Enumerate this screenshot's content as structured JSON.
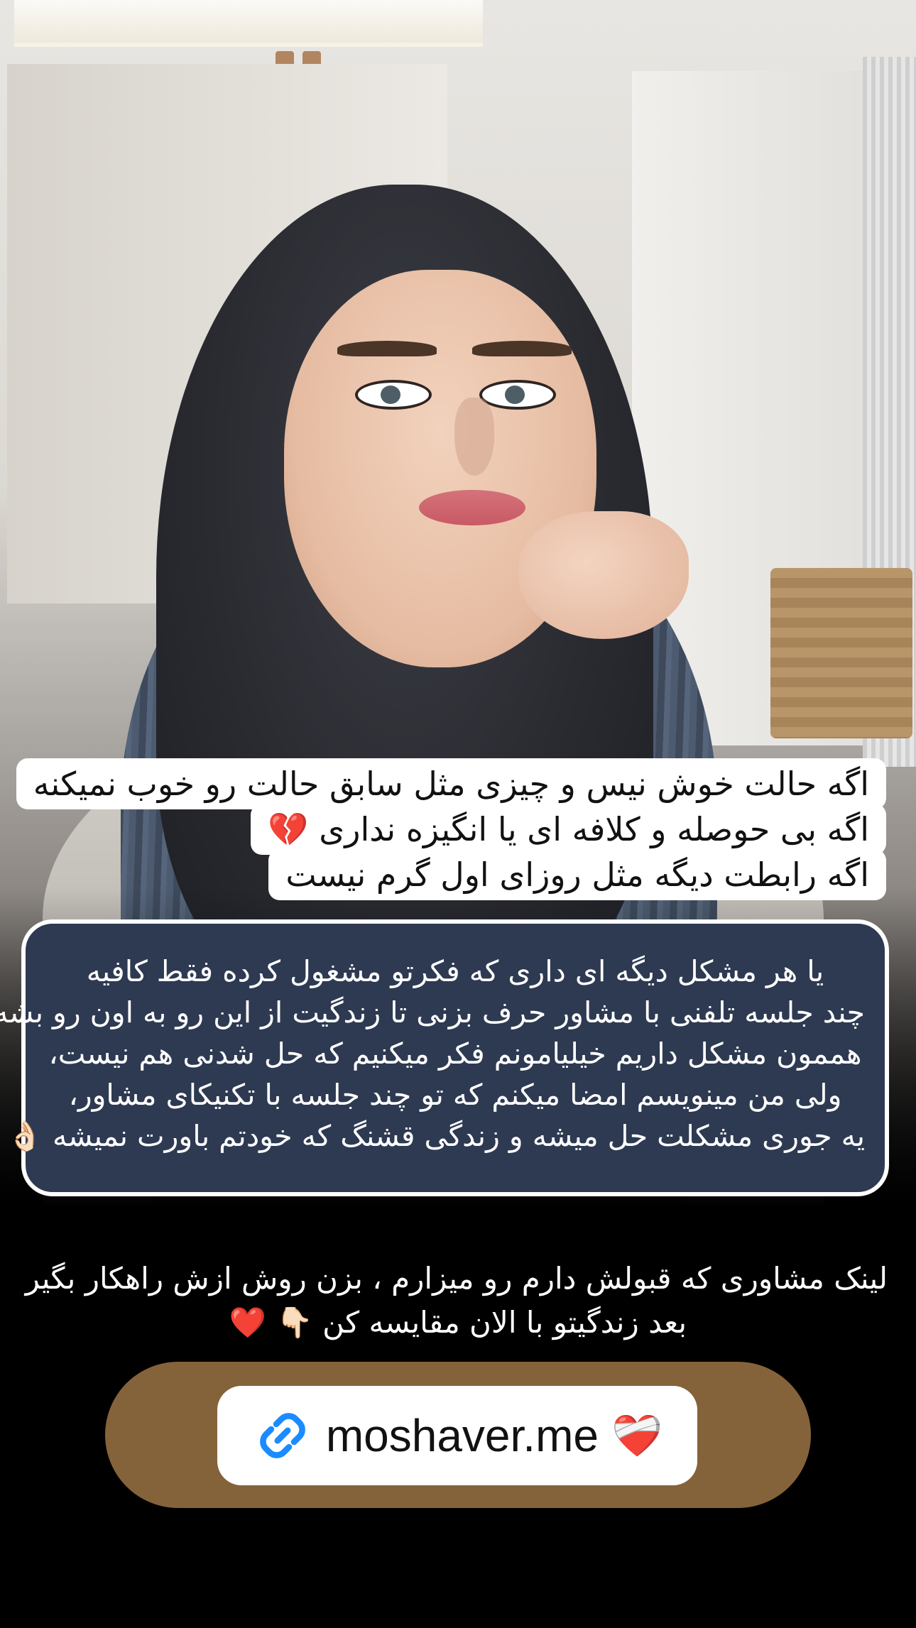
{
  "story": {
    "caption_lines": [
      "اگه حالت خوش نیس و چیزی مثل سابق حالت رو خوب نمیکنه",
      "اگه بی حوصله و کلافه ای یا انگیزه نداری 💔",
      "اگه رابطت دیگه مثل روزای اول گرم نیست"
    ],
    "message_lines": [
      "یا هر مشکل دیگه ای داری که فکرتو مشغول کرده فقط کافیه",
      "چند جلسه تلفنی با مشاور حرف بزنی تا زندگیت از این رو به اون رو بشه😎",
      "هممون مشکل داریم خیلیامونم فکر میکنیم که حل شدنی هم نیست،",
      "ولی من مینویسم امضا میکنم که تو چند جلسه با تکنیکای مشاور،",
      "یه جوری مشکلت حل میشه و زندگی قشنگ که خودتم باورت نمیشه 👌🏻"
    ],
    "promo_lines": [
      "لینک مشاوری که قبولش دارم رو میزارم ، بزن روش ازش راهکار بگیر",
      "بعد زندگیتو با الان مقایسه کن 👇🏻 ❤️"
    ],
    "link_sticker": {
      "icon": "link-icon",
      "url": "moshaver.me",
      "emoji": "❤️‍🩹"
    }
  },
  "colors": {
    "caption_bg": "#ffffff",
    "message_bg": "#2e3a52",
    "link_pill_bg": "#85633a",
    "link_icon": "#1a8cff"
  }
}
